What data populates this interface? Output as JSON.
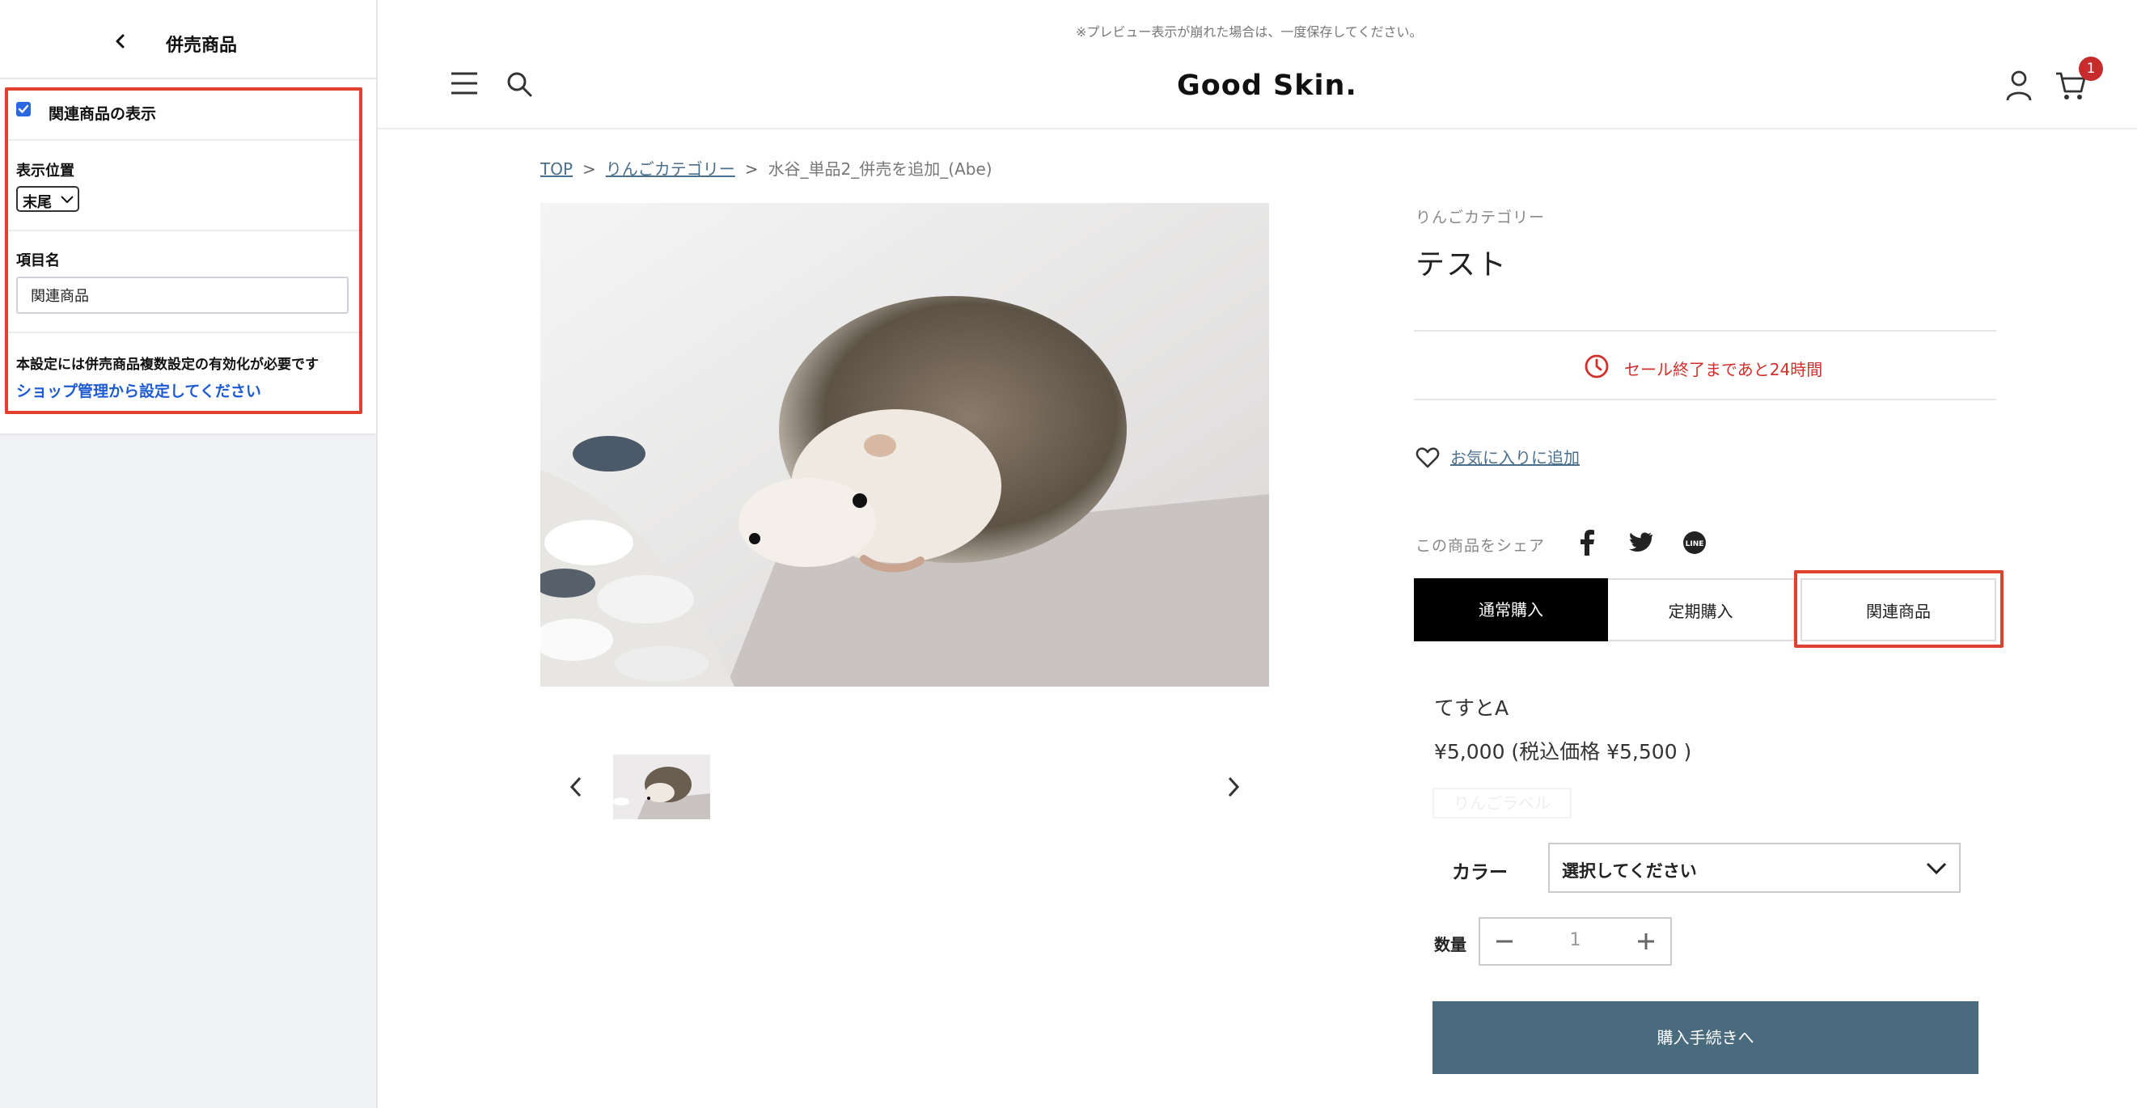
{
  "sidebar": {
    "title": "併売商品",
    "show_related_label": "関連商品の表示",
    "show_related_checked": true,
    "position_label": "表示位置",
    "position_value": "末尾",
    "item_name_label": "項目名",
    "item_name_value": "関連商品",
    "note": "本設定には併売商品複数設定の有効化が必要です",
    "note_link": "ショップ管理から設定してください"
  },
  "preview": {
    "notice": "※プレビュー表示が崩れた場合は、一度保存してください。",
    "logo": "Good Skin.",
    "cart_count": "1",
    "breadcrumb": {
      "top": "TOP",
      "category": "りんごカテゴリー",
      "current": "水谷_単品2_併売を追加_(Abe)"
    },
    "product": {
      "category": "りんごカテゴリー",
      "title": "テスト",
      "sale": "セール終了まであと24時間",
      "favorite": "お気に入りに追加",
      "share_label": "この商品をシェア",
      "tabs": {
        "normal": "通常購入",
        "subscription": "定期購入",
        "related": "関連商品"
      },
      "variant": "てすとA",
      "price": "¥5,000 (税込価格 ¥5,500 )",
      "faded_label": "りんごラベル",
      "color_label": "カラー",
      "color_placeholder": "選択してください",
      "qty_label": "数量",
      "qty_value": "1",
      "buy_button": "購入手続きへ"
    }
  },
  "colors": {
    "highlight": "#e0412f",
    "link_blue": "#1e5bd1",
    "sale_red": "#d0302b",
    "buy_button": "#4a6b7d",
    "badge": "#c82b2b"
  }
}
